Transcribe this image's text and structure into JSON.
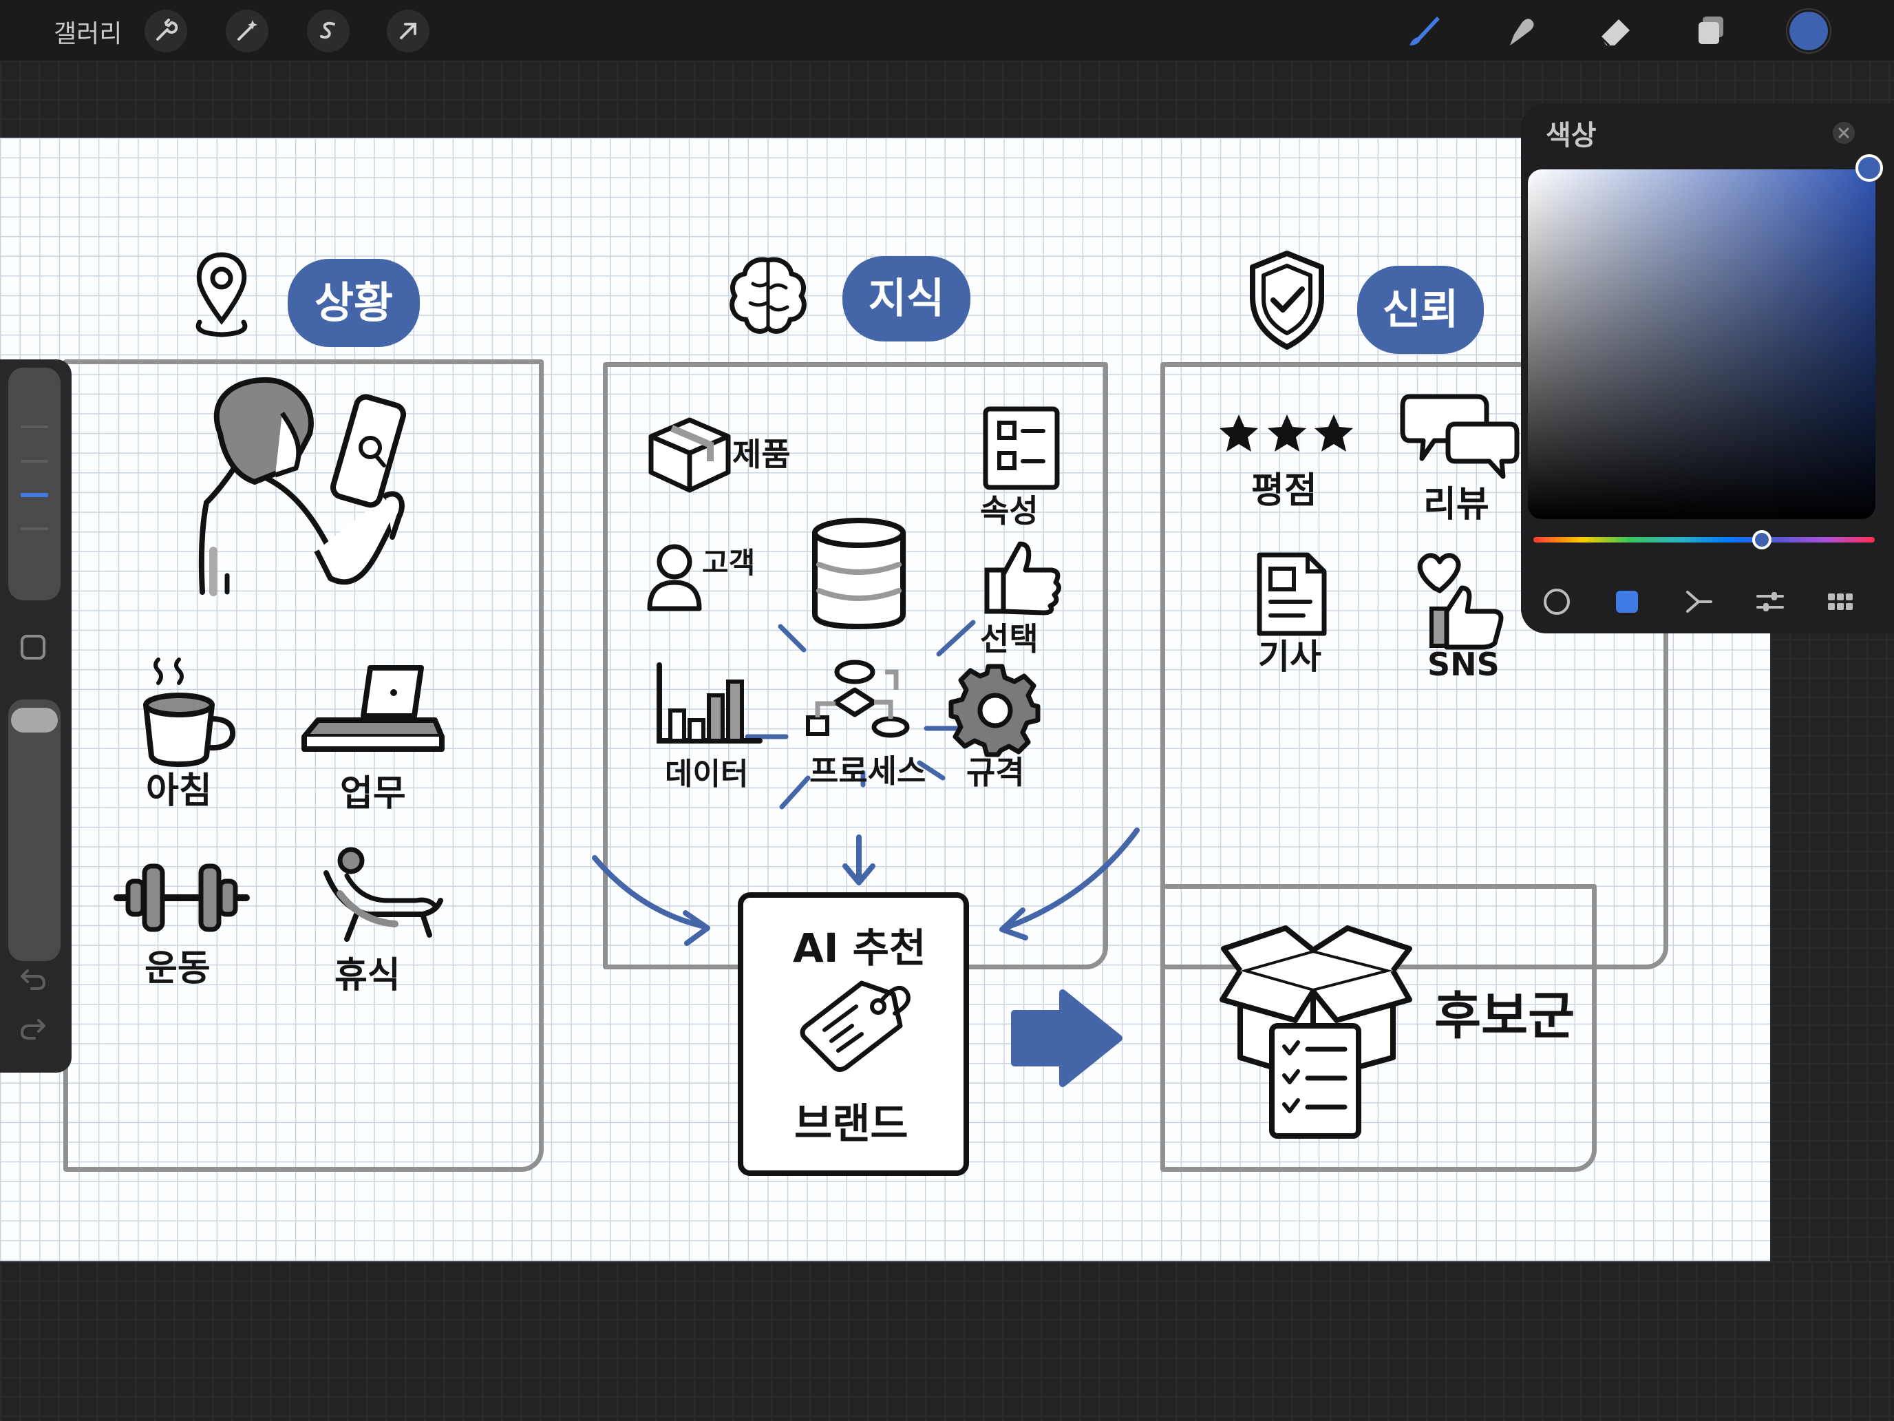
{
  "topbar": {
    "gallery_label": "갤러리",
    "left_tools": [
      "wrench-icon",
      "magic-wand-icon",
      "selection-s-icon",
      "transform-arrow-icon"
    ],
    "right_tools": [
      "brush-icon",
      "smudge-icon",
      "eraser-icon",
      "layers-icon"
    ],
    "current_color": "#3f62b0"
  },
  "color_panel": {
    "title": "색상",
    "tabs": [
      "disc-icon",
      "classic-square-icon",
      "harmony-icon",
      "value-sliders-icon",
      "palettes-icon"
    ],
    "selected_tab": "classic-square-icon",
    "hue_color": "#2f54b2"
  },
  "diagram": {
    "accent_color": "#4466a8",
    "context": {
      "tag": "상황",
      "items": [
        "아침",
        "업무",
        "운동",
        "휴식"
      ]
    },
    "knowledge": {
      "tag": "지식",
      "items": [
        "제품",
        "속성",
        "고객",
        "선택",
        "데이터",
        "프로세스",
        "규격"
      ]
    },
    "trust": {
      "tag": "신뢰",
      "items": [
        "평점",
        "리뷰",
        "기사",
        "SNS"
      ]
    },
    "ai_box": {
      "title": "AI 추천",
      "subtitle": "브랜드"
    },
    "result_label": "후보군"
  }
}
